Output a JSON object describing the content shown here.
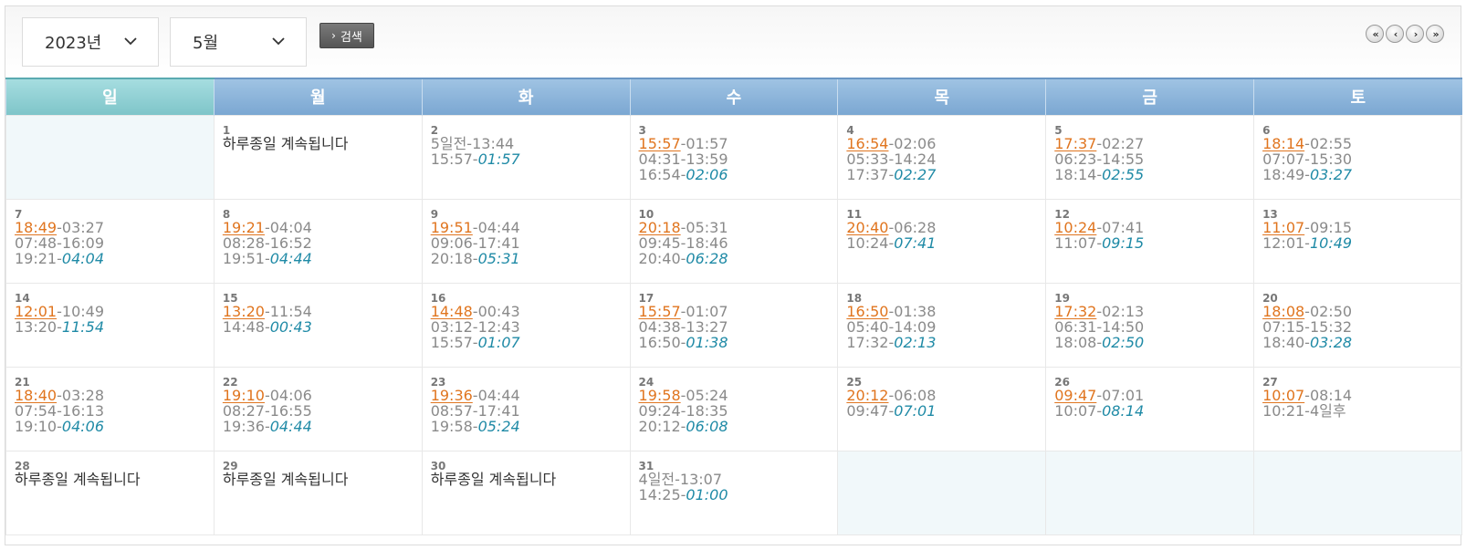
{
  "controls": {
    "year": "2023년",
    "month": "5월",
    "search_label": "검색",
    "pager": [
      "«",
      "‹",
      "›",
      "»"
    ]
  },
  "weekdays": [
    "일",
    "월",
    "화",
    "수",
    "목",
    "금",
    "토"
  ],
  "weeks": [
    [
      null,
      {
        "day": "1",
        "lines": [
          {
            "text": "하루종일 계속됩니다",
            "style": "dark"
          }
        ]
      },
      {
        "day": "2",
        "lines": [
          {
            "text": "5일전-13:44"
          },
          {
            "a": "15:57-",
            "b": "01:57"
          }
        ]
      },
      {
        "day": "3",
        "lines": [
          {
            "hl": "15:57",
            "rest": "-01:57"
          },
          {
            "text": "04:31-13:59"
          },
          {
            "a": "16:54-",
            "b": "02:06"
          }
        ]
      },
      {
        "day": "4",
        "lines": [
          {
            "hl": "16:54",
            "rest": "-02:06"
          },
          {
            "text": "05:33-14:24"
          },
          {
            "a": "17:37-",
            "b": "02:27"
          }
        ]
      },
      {
        "day": "5",
        "lines": [
          {
            "hl": "17:37",
            "rest": "-02:27"
          },
          {
            "text": "06:23-14:55"
          },
          {
            "a": "18:14-",
            "b": "02:55"
          }
        ]
      },
      {
        "day": "6",
        "lines": [
          {
            "hl": "18:14",
            "rest": "-02:55"
          },
          {
            "text": "07:07-15:30"
          },
          {
            "a": "18:49-",
            "b": "03:27"
          }
        ]
      }
    ],
    [
      {
        "day": "7",
        "lines": [
          {
            "hl": "18:49",
            "rest": "-03:27"
          },
          {
            "text": "07:48-16:09"
          },
          {
            "a": "19:21-",
            "b": "04:04"
          }
        ]
      },
      {
        "day": "8",
        "lines": [
          {
            "hl": "19:21",
            "rest": "-04:04"
          },
          {
            "text": "08:28-16:52"
          },
          {
            "a": "19:51-",
            "b": "04:44"
          }
        ]
      },
      {
        "day": "9",
        "lines": [
          {
            "hl": "19:51",
            "rest": "-04:44"
          },
          {
            "text": "09:06-17:41"
          },
          {
            "a": "20:18-",
            "b": "05:31"
          }
        ]
      },
      {
        "day": "10",
        "lines": [
          {
            "hl": "20:18",
            "rest": "-05:31"
          },
          {
            "text": "09:45-18:46"
          },
          {
            "a": "20:40-",
            "b": "06:28"
          }
        ]
      },
      {
        "day": "11",
        "lines": [
          {
            "hl": "20:40",
            "rest": "-06:28"
          },
          {
            "a": "10:24-",
            "b": "07:41"
          }
        ]
      },
      {
        "day": "12",
        "lines": [
          {
            "hl": "10:24",
            "rest": "-07:41"
          },
          {
            "a": "11:07-",
            "b": "09:15"
          }
        ]
      },
      {
        "day": "13",
        "lines": [
          {
            "hl": "11:07",
            "rest": "-09:15"
          },
          {
            "a": "12:01-",
            "b": "10:49"
          }
        ]
      }
    ],
    [
      {
        "day": "14",
        "lines": [
          {
            "hl": "12:01",
            "rest": "-10:49"
          },
          {
            "a": "13:20-",
            "b": "11:54"
          }
        ]
      },
      {
        "day": "15",
        "lines": [
          {
            "hl": "13:20",
            "rest": "-11:54"
          },
          {
            "a": "14:48-",
            "b": "00:43"
          }
        ]
      },
      {
        "day": "16",
        "lines": [
          {
            "hl": "14:48",
            "rest": "-00:43"
          },
          {
            "text": "03:12-12:43"
          },
          {
            "a": "15:57-",
            "b": "01:07"
          }
        ]
      },
      {
        "day": "17",
        "lines": [
          {
            "hl": "15:57",
            "rest": "-01:07"
          },
          {
            "text": "04:38-13:27"
          },
          {
            "a": "16:50-",
            "b": "01:38"
          }
        ]
      },
      {
        "day": "18",
        "lines": [
          {
            "hl": "16:50",
            "rest": "-01:38"
          },
          {
            "text": "05:40-14:09"
          },
          {
            "a": "17:32-",
            "b": "02:13"
          }
        ]
      },
      {
        "day": "19",
        "lines": [
          {
            "hl": "17:32",
            "rest": "-02:13"
          },
          {
            "text": "06:31-14:50"
          },
          {
            "a": "18:08-",
            "b": "02:50"
          }
        ]
      },
      {
        "day": "20",
        "lines": [
          {
            "hl": "18:08",
            "rest": "-02:50"
          },
          {
            "text": "07:15-15:32"
          },
          {
            "a": "18:40-",
            "b": "03:28"
          }
        ]
      }
    ],
    [
      {
        "day": "21",
        "lines": [
          {
            "hl": "18:40",
            "rest": "-03:28"
          },
          {
            "text": "07:54-16:13"
          },
          {
            "a": "19:10-",
            "b": "04:06"
          }
        ]
      },
      {
        "day": "22",
        "lines": [
          {
            "hl": "19:10",
            "rest": "-04:06"
          },
          {
            "text": "08:27-16:55"
          },
          {
            "a": "19:36-",
            "b": "04:44"
          }
        ]
      },
      {
        "day": "23",
        "lines": [
          {
            "hl": "19:36",
            "rest": "-04:44"
          },
          {
            "text": "08:57-17:41"
          },
          {
            "a": "19:58-",
            "b": "05:24"
          }
        ]
      },
      {
        "day": "24",
        "lines": [
          {
            "hl": "19:58",
            "rest": "-05:24"
          },
          {
            "text": "09:24-18:35"
          },
          {
            "a": "20:12-",
            "b": "06:08"
          }
        ]
      },
      {
        "day": "25",
        "lines": [
          {
            "hl": "20:12",
            "rest": "-06:08"
          },
          {
            "a": "09:47-",
            "b": "07:01"
          }
        ]
      },
      {
        "day": "26",
        "lines": [
          {
            "hl": "09:47",
            "rest": "-07:01"
          },
          {
            "a": "10:07-",
            "b": "08:14"
          }
        ]
      },
      {
        "day": "27",
        "lines": [
          {
            "hl": "10:07",
            "rest": "-08:14"
          },
          {
            "text": "10:21-4일후"
          }
        ]
      }
    ],
    [
      {
        "day": "28",
        "lines": [
          {
            "text": "하루종일 계속됩니다",
            "style": "dark"
          }
        ]
      },
      {
        "day": "29",
        "lines": [
          {
            "text": "하루종일 계속됩니다",
            "style": "dark"
          }
        ]
      },
      {
        "day": "30",
        "lines": [
          {
            "text": "하루종일 계속됩니다",
            "style": "dark"
          }
        ]
      },
      {
        "day": "31",
        "lines": [
          {
            "text": "4일전-13:07"
          },
          {
            "a": "14:25-",
            "b": "01:00"
          }
        ]
      },
      null,
      null,
      null
    ]
  ]
}
